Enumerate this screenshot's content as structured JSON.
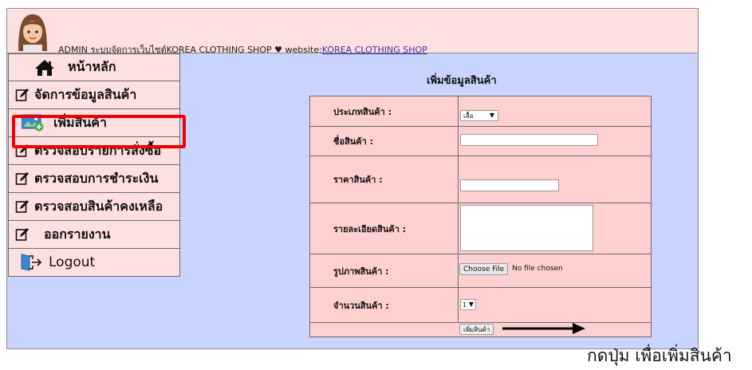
{
  "header": {
    "admin_text": "ADMIN ระบบจัดการเว็บไซต์KOREA CLOTHING SHOP ♥ website:",
    "site_link": "KOREA CLOTHING SHOP"
  },
  "sidebar": {
    "items": [
      {
        "label": "หน้าหลัก",
        "icon": "home-icon"
      },
      {
        "label": "จัดการข้อมูลสินค้า",
        "icon": "edit-icon"
      },
      {
        "label": "เพิ่มสินค้า",
        "icon": "image-add-icon"
      },
      {
        "label": "ตรวจสอบรายการสั่งซื้อ",
        "icon": "edit-icon"
      },
      {
        "label": "ตรวจสอบการชำระเงิน",
        "icon": "edit-icon"
      },
      {
        "label": "ตรวจสอบสินค้าคงเหลือ",
        "icon": "edit-icon"
      },
      {
        "label": "ออกรายงาน",
        "icon": "edit-icon"
      },
      {
        "label": "Logout",
        "icon": "logout-icon"
      }
    ]
  },
  "form": {
    "title": "เพิ่มข้อมูลสินค้า",
    "type_label": "ประเภทสินค้า :",
    "type_value": "เสื้อ",
    "name_label": "ชื่อสินค้า :",
    "name_value": "",
    "price_label": "ราคาสินค้า :",
    "price_value": "",
    "detail_label": "รายละเอียดสินค้า :",
    "detail_value": "",
    "image_label": "รูปภาพสินค้า :",
    "file_button": "Choose File",
    "file_status": "No file chosen",
    "qty_label": "จำนวนสินค้า :",
    "qty_value": "1",
    "submit_label": "เพิ่มสินค้า"
  },
  "caption": "กดปุ่ม เพื่อเพิ่มสินค้า",
  "colors": {
    "highlight": "#f00000",
    "background": "#c9d4ff",
    "panel": "#ffe0e0",
    "form_bg": "#ffd0d0"
  }
}
